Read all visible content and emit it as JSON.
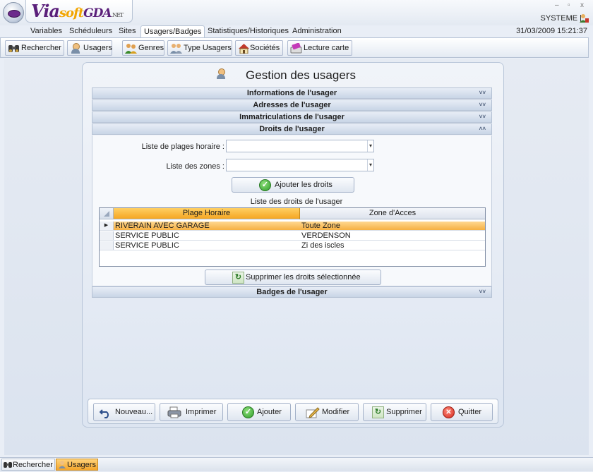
{
  "app": {
    "logo_text": "ViasoftGDA.NET",
    "window_controls": [
      "–",
      "▫",
      "x"
    ]
  },
  "user": {
    "name": "SYSTEME |",
    "datetime": "31/03/2009 15:21:37"
  },
  "menu": {
    "items": [
      "Variables",
      "Schéduleurs",
      "Sites",
      "Usagers/Badges",
      "Statistiques/Historiques",
      "Administration"
    ],
    "active": "Usagers/Badges"
  },
  "toolbar": {
    "buttons": [
      {
        "label": "Rechercher",
        "icon": "binoculars-icon"
      },
      {
        "label": "Usagers",
        "icon": "user-icon"
      },
      {
        "label": "Genres",
        "icon": "genres-icon"
      },
      {
        "label": "Type Usagers",
        "icon": "users-icon"
      },
      {
        "label": "Sociétés",
        "icon": "house-icon"
      },
      {
        "label": "Lecture carte",
        "icon": "card-reader-icon"
      }
    ]
  },
  "panel": {
    "title": "Gestion des usagers",
    "sections": [
      {
        "label": "Informations de l'usager",
        "state": "collapsed"
      },
      {
        "label": "Adresses de l'usager",
        "state": "collapsed"
      },
      {
        "label": "Immatriculations de l'usager",
        "state": "collapsed"
      },
      {
        "label": "Droits de l'usager",
        "state": "expanded"
      },
      {
        "label": "Badges de l'usager",
        "state": "collapsed"
      }
    ],
    "rights": {
      "time_ranges_label": "Liste de plages horaire :",
      "time_ranges_value": "",
      "zones_label": "Liste des zones :",
      "zones_value": "",
      "add_button": "Ajouter les droits",
      "grid_caption": "Liste des droits de l'usager",
      "columns": [
        "Plage Horaire",
        "Zone d'Acces"
      ],
      "rows": [
        [
          "RIVERAIN AVEC GARAGE",
          "Toute Zone"
        ],
        [
          "SERVICE PUBLIC",
          "VERDENSON"
        ],
        [
          "SERVICE PUBLIC",
          "Zi des iscles"
        ]
      ],
      "current_row": 0,
      "delete_button": "Supprimer les droits sélectionnée"
    },
    "actions": [
      {
        "label": "Nouveau...",
        "icon": "undo-icon"
      },
      {
        "label": "Imprimer",
        "icon": "printer-icon"
      },
      {
        "label": "Ajouter",
        "icon": "check-icon"
      },
      {
        "label": "Modifier",
        "icon": "edit-icon"
      },
      {
        "label": "Supprimer",
        "icon": "refresh-icon"
      },
      {
        "label": "Quitter",
        "icon": "close-icon"
      }
    ]
  },
  "taskbar": {
    "tabs": [
      "Rechercher",
      "Usagers"
    ],
    "active": "Usagers"
  },
  "colors": {
    "accent_orange": "#f5a623",
    "header_blue": "#c9d5e6",
    "logo_purple": "#5a1f7a"
  }
}
